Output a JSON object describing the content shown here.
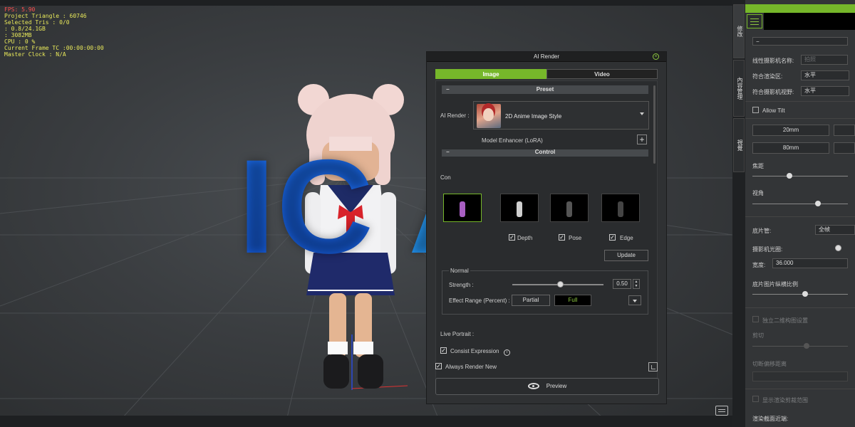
{
  "viewport": {
    "stats": {
      "fps": "FPS: 5.90",
      "project_triangle": "Project Triangle : 60746",
      "selected_tris": "Selected Tris : 0/0",
      "memory": "   : 0.8/24.1GB",
      "vram": "   : 3082MB",
      "cpu": "CPU : 0 %",
      "current_frame_tc": "Current Frame TC :00:00:00:00",
      "master_clock": "Master Clock : N/A"
    },
    "logo_text": {
      "left": "IC",
      "right": "AI"
    }
  },
  "ai_render": {
    "title": "AI Render",
    "tabs": [
      {
        "label": "Image",
        "active": true
      },
      {
        "label": "Video",
        "active": false
      }
    ],
    "preset_header": "Preset",
    "ai_render_label": "AI Render :",
    "preset_value": "2D Anime Image Style",
    "model_enhancer_label": "Model Enhancer (LoRA)",
    "control_header": "Control",
    "control_label_partial": "Con",
    "thumb_checks": [
      {
        "label": "Depth",
        "checked": true
      },
      {
        "label": "Pose",
        "checked": true
      },
      {
        "label": "Edge",
        "checked": true
      }
    ],
    "update_label": "Update",
    "normal_group_label": "Normal",
    "strength_label": "Strength :",
    "strength_value": "0.50",
    "effect_range_label": "Effect Range (Percent) :",
    "effect_range_options": [
      {
        "label": "Partial",
        "selected": false
      },
      {
        "label": "Full",
        "selected": true
      }
    ],
    "live_portrait_label": "Live Portrait :",
    "consist_expression_label": "Consist Expression",
    "always_render_new_label": "Always Render New",
    "preview_label": "Preview",
    "colors": {
      "accent": "#76b72a"
    }
  },
  "right_panel": {
    "side_tabs": [
      "修改",
      "內容管理",
      "視覺"
    ],
    "camera_name_label": "线性摄影机名称:",
    "camera_name_value": "拍照",
    "fit_render_label": "符合渲染区:",
    "fit_render_value": "水平",
    "fit_camera_label": "符合摄影机视野:",
    "fit_camera_value": "水平",
    "allow_tilt_label": "Allow Tilt",
    "lens_value_1": "20mm",
    "lens_value_2": "80mm",
    "focal_label": "焦距",
    "fov_label": "视角",
    "film_label": "底片管:",
    "film_value": "全帧",
    "aperture_label": "摄影机光圈:",
    "width_label": "宽度:",
    "width_value": "36.000",
    "ratio_label": "底片图片纵横比例",
    "ortho_label": "独立二维构图设置",
    "cut_label": "剪切",
    "clip_label": "切断偏移距离",
    "show_clip_label": "显示渲染剪裁范围",
    "render_near_label": "渲染截面近端:"
  }
}
